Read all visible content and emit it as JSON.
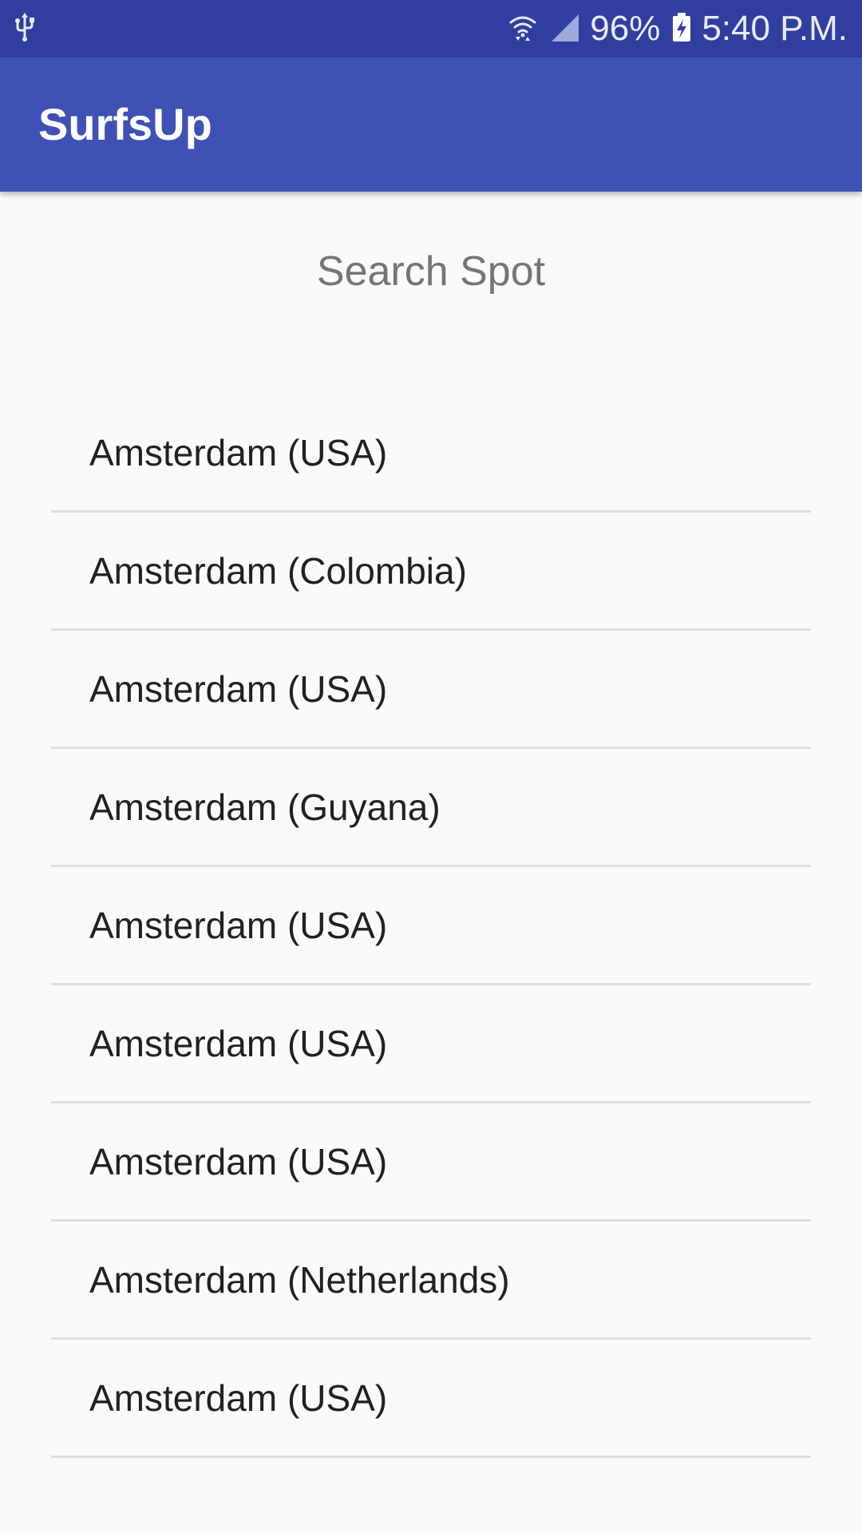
{
  "status_bar": {
    "battery_percent": "96%",
    "time": "5:40 P.M.",
    "icons": [
      "usb-icon",
      "wifi-icon",
      "cell-signal-icon",
      "battery-charging-icon"
    ]
  },
  "app_bar": {
    "title": "SurfsUp"
  },
  "search": {
    "placeholder": "Search Spot"
  },
  "results": [
    {
      "label": "Amsterdam (USA)"
    },
    {
      "label": "Amsterdam (Colombia)"
    },
    {
      "label": "Amsterdam (USA)"
    },
    {
      "label": "Amsterdam (Guyana)"
    },
    {
      "label": "Amsterdam (USA)"
    },
    {
      "label": "Amsterdam (USA)"
    },
    {
      "label": "Amsterdam (USA)"
    },
    {
      "label": "Amsterdam (Netherlands)"
    },
    {
      "label": "Amsterdam (USA)"
    }
  ],
  "colors": {
    "status_bar": "#303f9f",
    "app_bar": "#3f51b5",
    "background": "#fafafa",
    "divider": "#dedede"
  }
}
